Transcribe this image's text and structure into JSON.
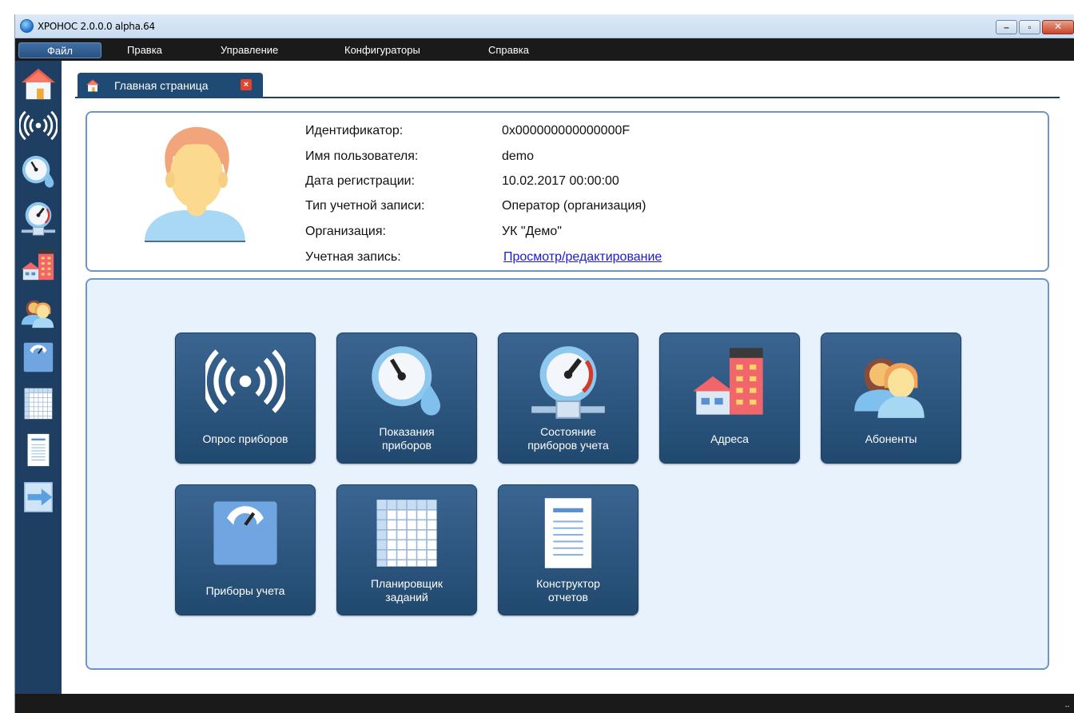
{
  "window": {
    "title": "ХРОНОС 2.0.0.0 alpha.64",
    "controls": [
      "minimize-icon",
      "maximize-icon",
      "close-icon"
    ]
  },
  "menu": {
    "items": [
      "Файл",
      "Правка",
      "Управление",
      "Конфигураторы",
      "Справка"
    ]
  },
  "sidebar": {
    "icons": [
      "home-icon",
      "radio-signal-icon",
      "meter-drop-icon",
      "pressure-gauge-icon",
      "buildings-icon",
      "users-icon",
      "scale-icon",
      "grid-icon",
      "report-icon",
      "exit-arrow-icon"
    ]
  },
  "tab": {
    "label": "Главная страница",
    "close": "×"
  },
  "profile": {
    "rows": [
      {
        "label": "Идентификатор:",
        "value": "0x000000000000000F"
      },
      {
        "label": "Имя пользователя:",
        "value": "demo"
      },
      {
        "label": "Дата регистрации:",
        "value": "10.02.2017 00:00:00"
      },
      {
        "label": "Тип учетной записи:",
        "value": "Оператор (организация)"
      },
      {
        "label": "Организация:",
        "value": "УК \"Демо\""
      },
      {
        "label": "Учетная запись:",
        "value": "Просмотр/редактирование"
      }
    ]
  },
  "tiles": [
    {
      "label": "Опрос приборов",
      "icon": "radio-signal-icon"
    },
    {
      "label": "Показания\nприборов",
      "icon": "meter-drop-icon"
    },
    {
      "label": "Состояние\nприборов учета",
      "icon": "pressure-gauge-icon"
    },
    {
      "label": "Адреса",
      "icon": "buildings-icon"
    },
    {
      "label": "Абоненты",
      "icon": "users-icon"
    },
    {
      "label": "Приборы учета",
      "icon": "scale-icon"
    },
    {
      "label": "Планировщик\nзаданий",
      "icon": "grid-icon"
    },
    {
      "label": "Конструктор\nотчетов",
      "icon": "report-icon"
    }
  ],
  "colors": {
    "accent": "#1e3f62",
    "tile": "#2c5580",
    "panel_border": "#6f95c4",
    "panel_bg": "#e8f2fc",
    "close_red": "#e2452c"
  }
}
